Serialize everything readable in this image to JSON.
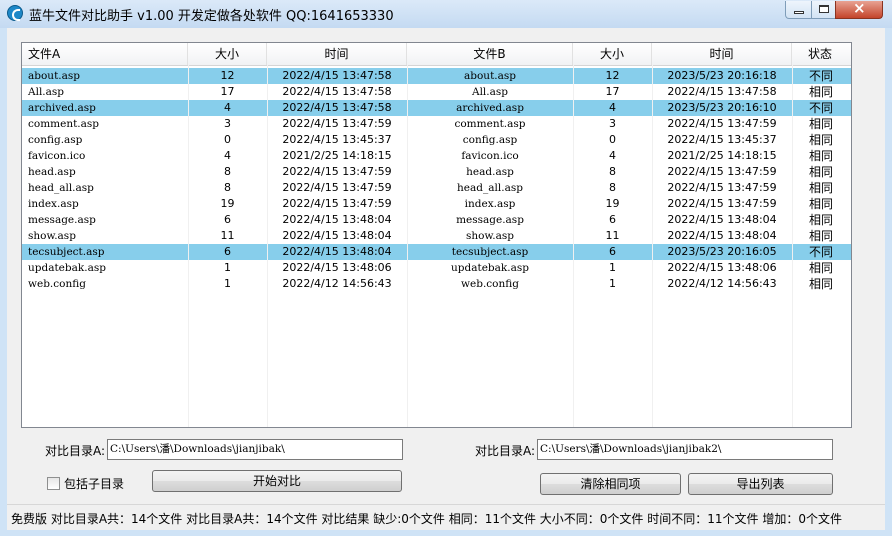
{
  "window": {
    "title": "蓝牛文件对比助手 v1.00 开发定做各处软件 QQ:1641653330"
  },
  "columns": [
    "文件A",
    "大小",
    "时间",
    "文件B",
    "大小",
    "时间",
    "状态"
  ],
  "rows": [
    {
      "a": "about.asp",
      "sa": "12",
      "ta": "2022/4/15 13:47:58",
      "b": "about.asp",
      "sb": "12",
      "tb": "2023/5/23 20:16:18",
      "st": "不同",
      "sel": true
    },
    {
      "a": "All.asp",
      "sa": "17",
      "ta": "2022/4/15 13:47:58",
      "b": "All.asp",
      "sb": "17",
      "tb": "2022/4/15 13:47:58",
      "st": "相同",
      "sel": false
    },
    {
      "a": "archived.asp",
      "sa": "4",
      "ta": "2022/4/15 13:47:58",
      "b": "archived.asp",
      "sb": "4",
      "tb": "2023/5/23 20:16:10",
      "st": "不同",
      "sel": true
    },
    {
      "a": "comment.asp",
      "sa": "3",
      "ta": "2022/4/15 13:47:59",
      "b": "comment.asp",
      "sb": "3",
      "tb": "2022/4/15 13:47:59",
      "st": "相同",
      "sel": false
    },
    {
      "a": "config.asp",
      "sa": "0",
      "ta": "2022/4/15 13:45:37",
      "b": "config.asp",
      "sb": "0",
      "tb": "2022/4/15 13:45:37",
      "st": "相同",
      "sel": false
    },
    {
      "a": "favicon.ico",
      "sa": "4",
      "ta": "2021/2/25 14:18:15",
      "b": "favicon.ico",
      "sb": "4",
      "tb": "2021/2/25 14:18:15",
      "st": "相同",
      "sel": false
    },
    {
      "a": "head.asp",
      "sa": "8",
      "ta": "2022/4/15 13:47:59",
      "b": "head.asp",
      "sb": "8",
      "tb": "2022/4/15 13:47:59",
      "st": "相同",
      "sel": false
    },
    {
      "a": "head_all.asp",
      "sa": "8",
      "ta": "2022/4/15 13:47:59",
      "b": "head_all.asp",
      "sb": "8",
      "tb": "2022/4/15 13:47:59",
      "st": "相同",
      "sel": false
    },
    {
      "a": "index.asp",
      "sa": "19",
      "ta": "2022/4/15 13:47:59",
      "b": "index.asp",
      "sb": "19",
      "tb": "2022/4/15 13:47:59",
      "st": "相同",
      "sel": false
    },
    {
      "a": "message.asp",
      "sa": "6",
      "ta": "2022/4/15 13:48:04",
      "b": "message.asp",
      "sb": "6",
      "tb": "2022/4/15 13:48:04",
      "st": "相同",
      "sel": false
    },
    {
      "a": "show.asp",
      "sa": "11",
      "ta": "2022/4/15 13:48:04",
      "b": "show.asp",
      "sb": "11",
      "tb": "2022/4/15 13:48:04",
      "st": "相同",
      "sel": false
    },
    {
      "a": "tecsubject.asp",
      "sa": "6",
      "ta": "2022/4/15 13:48:04",
      "b": "tecsubject.asp",
      "sb": "6",
      "tb": "2023/5/23 20:16:05",
      "st": "不同",
      "sel": true
    },
    {
      "a": "updatebak.asp",
      "sa": "1",
      "ta": "2022/4/15 13:48:06",
      "b": "updatebak.asp",
      "sb": "1",
      "tb": "2022/4/15 13:48:06",
      "st": "相同",
      "sel": false
    },
    {
      "a": "web.config",
      "sa": "1",
      "ta": "2022/4/12 14:56:43",
      "b": "web.config",
      "sb": "1",
      "tb": "2022/4/12 14:56:43",
      "st": "相同",
      "sel": false
    }
  ],
  "form": {
    "dir_a_label": "对比目录A:",
    "dir_a_value": "C:\\Users\\潘\\Downloads\\jianjibak\\",
    "dir_b_label": "对比目录A:",
    "dir_b_value": "C:\\Users\\潘\\Downloads\\jianjibak2\\",
    "include_sub_label": "包括子目录",
    "include_sub_checked": false,
    "compare_button": "开始对比",
    "clear_same_button": "清除相同项",
    "export_button": "导出列表"
  },
  "status_text": "免费版  对比目录A共：14个文件  对比目录A共：14个文件  对比结果 缺少:0个文件 相同：11个文件 大小不同：0个文件 时间不同：11个文件 增加：0个文件",
  "colors": {
    "selected_row": "#87ceeb",
    "title_bar": "#cfe3f6",
    "close_button": "#c4442b"
  }
}
